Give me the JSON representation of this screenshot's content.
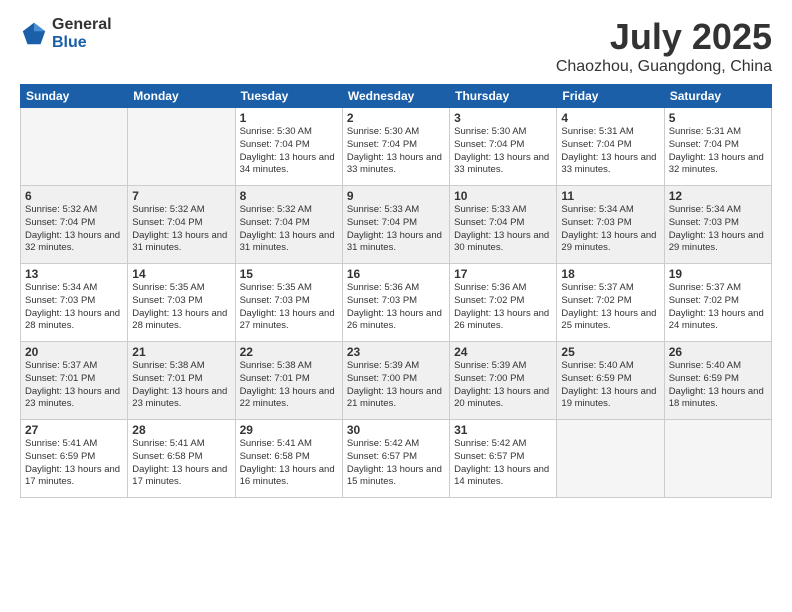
{
  "logo": {
    "general": "General",
    "blue": "Blue"
  },
  "title": "July 2025",
  "location": "Chaozhou, Guangdong, China",
  "days_of_week": [
    "Sunday",
    "Monday",
    "Tuesday",
    "Wednesday",
    "Thursday",
    "Friday",
    "Saturday"
  ],
  "weeks": [
    [
      {
        "day": "",
        "empty": true
      },
      {
        "day": "",
        "empty": true
      },
      {
        "day": "1",
        "sunrise": "Sunrise: 5:30 AM",
        "sunset": "Sunset: 7:04 PM",
        "daylight": "Daylight: 13 hours and 34 minutes."
      },
      {
        "day": "2",
        "sunrise": "Sunrise: 5:30 AM",
        "sunset": "Sunset: 7:04 PM",
        "daylight": "Daylight: 13 hours and 33 minutes."
      },
      {
        "day": "3",
        "sunrise": "Sunrise: 5:30 AM",
        "sunset": "Sunset: 7:04 PM",
        "daylight": "Daylight: 13 hours and 33 minutes."
      },
      {
        "day": "4",
        "sunrise": "Sunrise: 5:31 AM",
        "sunset": "Sunset: 7:04 PM",
        "daylight": "Daylight: 13 hours and 33 minutes."
      },
      {
        "day": "5",
        "sunrise": "Sunrise: 5:31 AM",
        "sunset": "Sunset: 7:04 PM",
        "daylight": "Daylight: 13 hours and 32 minutes."
      }
    ],
    [
      {
        "day": "6",
        "sunrise": "Sunrise: 5:32 AM",
        "sunset": "Sunset: 7:04 PM",
        "daylight": "Daylight: 13 hours and 32 minutes."
      },
      {
        "day": "7",
        "sunrise": "Sunrise: 5:32 AM",
        "sunset": "Sunset: 7:04 PM",
        "daylight": "Daylight: 13 hours and 31 minutes."
      },
      {
        "day": "8",
        "sunrise": "Sunrise: 5:32 AM",
        "sunset": "Sunset: 7:04 PM",
        "daylight": "Daylight: 13 hours and 31 minutes."
      },
      {
        "day": "9",
        "sunrise": "Sunrise: 5:33 AM",
        "sunset": "Sunset: 7:04 PM",
        "daylight": "Daylight: 13 hours and 31 minutes."
      },
      {
        "day": "10",
        "sunrise": "Sunrise: 5:33 AM",
        "sunset": "Sunset: 7:04 PM",
        "daylight": "Daylight: 13 hours and 30 minutes."
      },
      {
        "day": "11",
        "sunrise": "Sunrise: 5:34 AM",
        "sunset": "Sunset: 7:03 PM",
        "daylight": "Daylight: 13 hours and 29 minutes."
      },
      {
        "day": "12",
        "sunrise": "Sunrise: 5:34 AM",
        "sunset": "Sunset: 7:03 PM",
        "daylight": "Daylight: 13 hours and 29 minutes."
      }
    ],
    [
      {
        "day": "13",
        "sunrise": "Sunrise: 5:34 AM",
        "sunset": "Sunset: 7:03 PM",
        "daylight": "Daylight: 13 hours and 28 minutes."
      },
      {
        "day": "14",
        "sunrise": "Sunrise: 5:35 AM",
        "sunset": "Sunset: 7:03 PM",
        "daylight": "Daylight: 13 hours and 28 minutes."
      },
      {
        "day": "15",
        "sunrise": "Sunrise: 5:35 AM",
        "sunset": "Sunset: 7:03 PM",
        "daylight": "Daylight: 13 hours and 27 minutes."
      },
      {
        "day": "16",
        "sunrise": "Sunrise: 5:36 AM",
        "sunset": "Sunset: 7:03 PM",
        "daylight": "Daylight: 13 hours and 26 minutes."
      },
      {
        "day": "17",
        "sunrise": "Sunrise: 5:36 AM",
        "sunset": "Sunset: 7:02 PM",
        "daylight": "Daylight: 13 hours and 26 minutes."
      },
      {
        "day": "18",
        "sunrise": "Sunrise: 5:37 AM",
        "sunset": "Sunset: 7:02 PM",
        "daylight": "Daylight: 13 hours and 25 minutes."
      },
      {
        "day": "19",
        "sunrise": "Sunrise: 5:37 AM",
        "sunset": "Sunset: 7:02 PM",
        "daylight": "Daylight: 13 hours and 24 minutes."
      }
    ],
    [
      {
        "day": "20",
        "sunrise": "Sunrise: 5:37 AM",
        "sunset": "Sunset: 7:01 PM",
        "daylight": "Daylight: 13 hours and 23 minutes."
      },
      {
        "day": "21",
        "sunrise": "Sunrise: 5:38 AM",
        "sunset": "Sunset: 7:01 PM",
        "daylight": "Daylight: 13 hours and 23 minutes."
      },
      {
        "day": "22",
        "sunrise": "Sunrise: 5:38 AM",
        "sunset": "Sunset: 7:01 PM",
        "daylight": "Daylight: 13 hours and 22 minutes."
      },
      {
        "day": "23",
        "sunrise": "Sunrise: 5:39 AM",
        "sunset": "Sunset: 7:00 PM",
        "daylight": "Daylight: 13 hours and 21 minutes."
      },
      {
        "day": "24",
        "sunrise": "Sunrise: 5:39 AM",
        "sunset": "Sunset: 7:00 PM",
        "daylight": "Daylight: 13 hours and 20 minutes."
      },
      {
        "day": "25",
        "sunrise": "Sunrise: 5:40 AM",
        "sunset": "Sunset: 6:59 PM",
        "daylight": "Daylight: 13 hours and 19 minutes."
      },
      {
        "day": "26",
        "sunrise": "Sunrise: 5:40 AM",
        "sunset": "Sunset: 6:59 PM",
        "daylight": "Daylight: 13 hours and 18 minutes."
      }
    ],
    [
      {
        "day": "27",
        "sunrise": "Sunrise: 5:41 AM",
        "sunset": "Sunset: 6:59 PM",
        "daylight": "Daylight: 13 hours and 17 minutes."
      },
      {
        "day": "28",
        "sunrise": "Sunrise: 5:41 AM",
        "sunset": "Sunset: 6:58 PM",
        "daylight": "Daylight: 13 hours and 17 minutes."
      },
      {
        "day": "29",
        "sunrise": "Sunrise: 5:41 AM",
        "sunset": "Sunset: 6:58 PM",
        "daylight": "Daylight: 13 hours and 16 minutes."
      },
      {
        "day": "30",
        "sunrise": "Sunrise: 5:42 AM",
        "sunset": "Sunset: 6:57 PM",
        "daylight": "Daylight: 13 hours and 15 minutes."
      },
      {
        "day": "31",
        "sunrise": "Sunrise: 5:42 AM",
        "sunset": "Sunset: 6:57 PM",
        "daylight": "Daylight: 13 hours and 14 minutes."
      },
      {
        "day": "",
        "empty": true
      },
      {
        "day": "",
        "empty": true
      }
    ]
  ]
}
